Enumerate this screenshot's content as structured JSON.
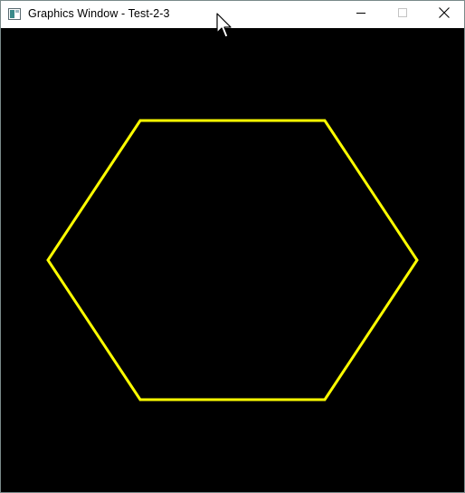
{
  "window": {
    "title": "Graphics Window - Test-2-3",
    "icon": "app-window-icon",
    "controls": {
      "minimize_icon": "minimize-icon",
      "maximize_icon": "maximize-icon",
      "close_icon": "close-icon"
    }
  },
  "canvas": {
    "background_color": "#000000",
    "shape": {
      "type": "hexagon",
      "stroke_color": "#ffff00",
      "fill": "none"
    }
  },
  "cursor": {
    "icon": "mouse-pointer-icon"
  }
}
